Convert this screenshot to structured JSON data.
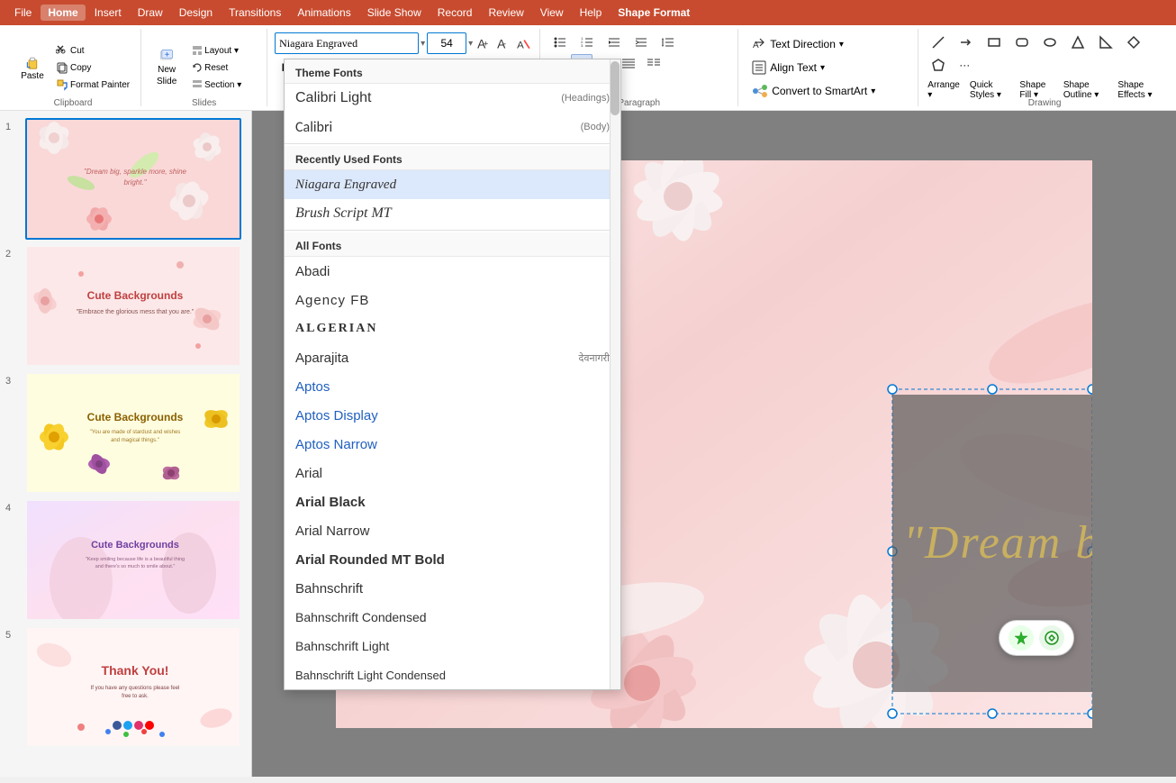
{
  "app": {
    "title": "PowerPoint",
    "menu_items": [
      "File",
      "Home",
      "Insert",
      "Draw",
      "Design",
      "Transitions",
      "Animations",
      "Slide Show",
      "Record",
      "Review",
      "View",
      "Help",
      "Shape Format"
    ],
    "active_menu": "Home",
    "special_tab": "Shape Format"
  },
  "toolbar": {
    "clipboard_label": "Clipboard",
    "slides_label": "Slides",
    "paste_label": "Paste",
    "cut_label": "Cut",
    "copy_label": "Copy",
    "format_painter_label": "Format Painter",
    "new_slide_label": "New\nSlide",
    "layout_label": "Layout",
    "reset_label": "Reset",
    "section_label": "Section",
    "font_value": "Niagara Engraved",
    "font_size": "54",
    "paragraph_label": "Paragraph",
    "text_direction_label": "Text Direction",
    "align_text_label": "Align Text",
    "convert_smartart_label": "Convert to SmartArt"
  },
  "font_dropdown": {
    "theme_fonts_label": "Theme Fonts",
    "recently_used_label": "Recently Used Fonts",
    "all_fonts_label": "All Fonts",
    "theme_fonts": [
      {
        "name": "Calibri Light",
        "tag": "(Headings)"
      },
      {
        "name": "Calibri",
        "tag": "(Body)"
      }
    ],
    "recently_used": [
      {
        "name": "Niagara Engraved",
        "tag": ""
      },
      {
        "name": "Brush Script MT",
        "tag": ""
      }
    ],
    "all_fonts": [
      {
        "name": "Abadi",
        "tag": "",
        "style": "abadi"
      },
      {
        "name": "Agency FB",
        "tag": "",
        "style": "agency"
      },
      {
        "name": "ALGERIAN",
        "tag": "",
        "style": "algerian"
      },
      {
        "name": "Aparajita",
        "tag": "देवनागरी",
        "style": "aparajita"
      },
      {
        "name": "Aptos",
        "tag": "",
        "style": "aptos"
      },
      {
        "name": "Aptos Display",
        "tag": "",
        "style": "aptos-display"
      },
      {
        "name": "Aptos Narrow",
        "tag": "",
        "style": "aptos-narrow"
      },
      {
        "name": "Arial",
        "tag": "",
        "style": "arial"
      },
      {
        "name": "Arial Black",
        "tag": "",
        "style": "arial-black"
      },
      {
        "name": "Arial Narrow",
        "tag": "",
        "style": "arial-narrow"
      },
      {
        "name": "Arial Rounded MT Bold",
        "tag": "",
        "style": "arial-rounded"
      },
      {
        "name": "Bahnschrift",
        "tag": "",
        "style": "bahnschrift"
      },
      {
        "name": "Bahnschrift Condensed",
        "tag": "",
        "style": "bahnschrift-condensed"
      },
      {
        "name": "Bahnschrift Light",
        "tag": "",
        "style": "bahnschrift-light"
      },
      {
        "name": "Bahnschrift Light Condensed",
        "tag": "",
        "style": "bahnschrift-light-condensed"
      }
    ]
  },
  "slides": [
    {
      "num": "1",
      "title": "Dream big, sparkle more, shine bright.",
      "subtitle": "",
      "type": "floral_pink",
      "selected": true
    },
    {
      "num": "2",
      "title": "Cute Backgrounds",
      "subtitle": "Embrace the glorious mess that you are.",
      "type": "pink_cute"
    },
    {
      "num": "3",
      "title": "Cute Backgrounds",
      "subtitle": "You are made of stardust and wishes and magical things.",
      "type": "yellow_cute"
    },
    {
      "num": "4",
      "title": "Cute Backgrounds",
      "subtitle": "Keep smiling because life is a beautiful thing and there's so much to smile about.",
      "type": "purple_cute"
    },
    {
      "num": "5",
      "title": "Thank You!",
      "subtitle": "If you have any questions please feel free to ask.",
      "type": "thank_you"
    }
  ],
  "main_slide": {
    "text": "\"Dream big,",
    "font": "Niagara Engraved"
  },
  "floating_tools": {
    "tool1": "magic",
    "tool2": "arrows"
  }
}
